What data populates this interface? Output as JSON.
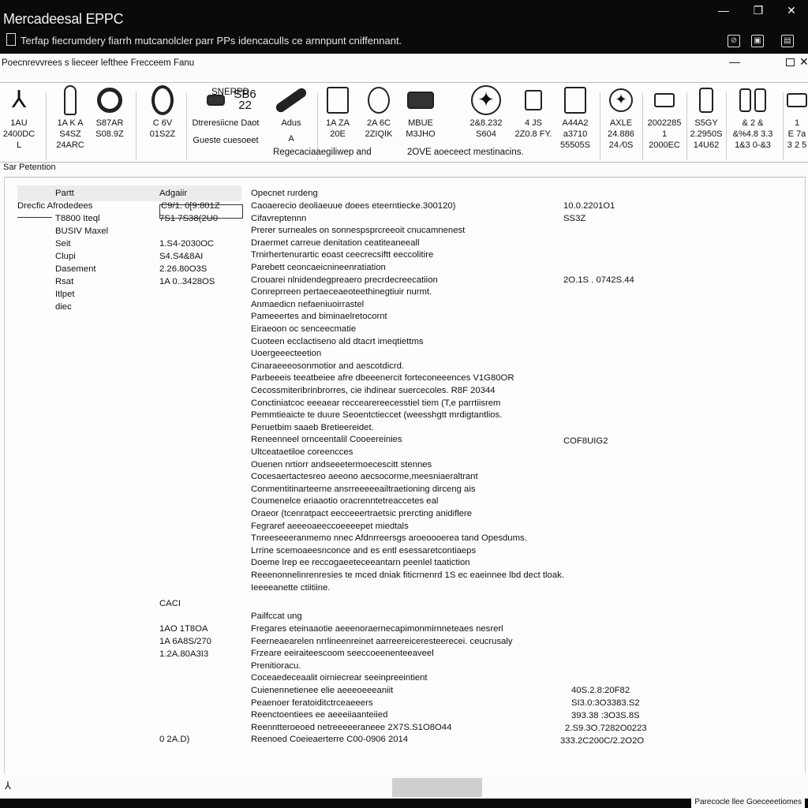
{
  "window": {
    "title": "Mercadeesal EPPC",
    "subtitle": "Terfap fiecrumdery fiarrh mutcanolcler parr PPs idencaculls ce arnnpunt cniffennant.",
    "controls": {
      "minimize": "—",
      "restore": "❐",
      "close": "✕"
    },
    "tray": [
      "⊘",
      "▣",
      "▤"
    ]
  },
  "menubar": {
    "text": "Poecnrevvrees s lieceer lefthee Frecceem Fanu",
    "min": "—",
    "close": "✕"
  },
  "toolbar": {
    "tools": [
      {
        "icon": "tri-star-icon",
        "glyph": "⅄",
        "lines": [
          "1AU",
          "2400DC",
          "L"
        ]
      },
      {
        "icon": "wrench-icon",
        "glyph": "",
        "lines": [
          "1A K A",
          "S4SZ",
          "24ARC"
        ]
      },
      {
        "icon": "seal-ring-icon",
        "glyph": "",
        "lines": [
          "",
          "S87AR",
          "S08.9Z"
        ]
      },
      {
        "icon": "o-ring-icon",
        "glyph": "",
        "lines": [
          "",
          "C 6V",
          "01S2Z"
        ]
      },
      {
        "icon": "engine-icon",
        "glyph": "",
        "lines": [
          "",
          "Dtreresiicne Daot",
          "Gueste cuesoeet"
        ]
      },
      {
        "icon": "rod-icon",
        "glyph": "",
        "lines": [
          "",
          "Adus",
          "A"
        ]
      },
      {
        "icon": "pump-icon",
        "glyph": "",
        "lines": [
          "",
          "1A ZA",
          "20E"
        ]
      },
      {
        "icon": "gear-pump-icon",
        "glyph": "",
        "lines": [
          "",
          "2A 6C",
          "2ZIQIK"
        ]
      },
      {
        "icon": "cylinder-icon",
        "glyph": "",
        "lines": [
          "",
          "MBUE",
          "M3JHO"
        ]
      },
      {
        "icon": "star-emblem-icon",
        "glyph": "✦",
        "lines": [
          "",
          "2&8.232",
          "S604"
        ]
      },
      {
        "icon": "bracket-icon",
        "glyph": "",
        "lines": [
          "",
          "4 JS",
          "2Z0.8 FY."
        ]
      },
      {
        "icon": "filter-icon",
        "glyph": "",
        "lines": [
          "",
          "A44A2",
          "a3710",
          "55505S"
        ]
      },
      {
        "icon": "star-badge-icon",
        "glyph": "✦",
        "lines": [
          "",
          "AXLE",
          "24.886",
          "24 ⁄0S"
        ]
      },
      {
        "icon": "module-icon",
        "glyph": "",
        "lines": [
          "",
          "2002285",
          "1",
          "2000EC"
        ]
      },
      {
        "icon": "sensor-icon",
        "glyph": "",
        "lines": [
          "",
          "S5GY",
          "2.2950S",
          "14U62"
        ]
      },
      {
        "icon": "valve-pair-icon",
        "glyph": "",
        "lines": [
          "",
          "& 2 &",
          "&%4.8 3.3",
          "1&3 0-&3"
        ]
      },
      {
        "icon": "connector-icon",
        "glyph": "",
        "lines": [
          "",
          "1",
          "E 7a",
          "3 2 5"
        ]
      }
    ],
    "top_label": "SNERPD",
    "part_label": "SB6 22",
    "note_mid": "Regecaciaaegiliwep and",
    "note_right": "2OVE aoeceect mestinacins."
  },
  "section_title": "Sar Petention",
  "combo": {
    "value": "",
    "arrow": "▼"
  },
  "left_grid": {
    "headers": [
      "Partt",
      "Adgaiir"
    ],
    "col1": [
      "Drecfic Afrodedees",
      "T8800 Iteql",
      "BUSIV Maxel",
      "Seit",
      "Clupi",
      "Dasement",
      "Rsat",
      "Itlpet",
      "diec"
    ],
    "col2": [
      "C9/1. 0[9:801Z",
      "7S1  7S38(2U0",
      "",
      "1.S4-2030OC",
      "S4.S4&8AI",
      "2.26.80O3S",
      "1A 0..3428OS"
    ],
    "lower_col2": [
      "CACI",
      "",
      "1AO 1T8OA",
      "1A 6A8S/270",
      "1.2A.80A3I3",
      "",
      "",
      "",
      "",
      "",
      "0 2A.D)"
    ]
  },
  "description": {
    "header": "Opecnet rurdeng",
    "lines": [
      "Caoaerecio deoliaeuue doees eteerntiecke.300120)",
      "Cifavreptennn",
      "Prerer surneales on sonnespsprcreeoit cnucamnenest",
      "Draermet carreue denitation ceatiteaneeall",
      "Trnirhertenurartic eoast ceecrecsiftt eeccolitire",
      "Parebett ceoncaeicnineenratiation",
      "Crouarei nlnidendegpreaero precrdecreecatiion",
      "Conreprreen pertaeceaeoteethinegtiuir nurmt.",
      "Anmaedicn nefaeniuoirrastel",
      "Pameeertes and biminaelretocornt",
      "Eiraeoon oc senceecmatie",
      "Cuoteen ecclactiseno ald dtacrt imeqtiettms",
      "Uoergeeecteetion",
      "Cinaraeeeosonmotior and aescotdicrd.",
      "Parbeeeis teeatbeiee afre dbeeenercit forteconeeences V1G80OR",
      "Cecossmiteribrinbrorres, cie ihdinear suercecoles. R8F 20344",
      "Conctiniatcoc eeeaear reccearereecesstiel tiem (T,e parrtiisrem",
      "Pemmtieaicte te duure Seoentctieccet (weesshgtt mrdigtantlios.",
      "Peruetbim saaeb Bretieereidet.",
      "Reneenneel ornceentalil Cooeereinies",
      "Ultceataetiloe coreencces",
      "Ouenen nrtiorr andseeetermoecescitt stennes",
      "Cocesaertactesreo aeeono aecsocorme,meesniaeraltrant",
      "Conmentitinarteerne ansrreeeeeailtraetioning dirceng ais",
      "Coumenelce eriaaotio oracrenntetreaccetes eal",
      "Oraeor (tcenratpact eecceeertraetsic prercting anidiflere",
      "Fegraref aeeeoaeeccoeeeepet miedtals",
      "Tnreeseeeranmemo nnec Afdnrreersgs aroeoooerea tand Opesdums.",
      "Lrrine scemoaeesnconce and es entl esessaretcontiaeps",
      "Doeme lrep ee reccogaeeteceeantarn peenlel taatiction",
      "Reeenonnelinrenresies te mced dniak  fiticrnenrd 1S ec eaeinnee lbd dect tloak.",
      "Ieeeeanette ctiitiine."
    ],
    "header2": "Pailfccat ung",
    "lines2": [
      "Fregares eteinaaotie aeeenoraernecapimonmirnneteaes nesrerl",
      "Feerneaearelen nrrlineenreinet aarreereiceresteerecei. ceucrusaly",
      "Frzeare eeiraiteescoom seeccoeenenteeaveel",
      "Prenitioracu.",
      "Coceaedeceaalit oirniecrear seeinpreeintient",
      "Cuienennetienee elie aeeeoeeeaniit",
      "Peaenoer feratoiditctrceaeeers",
      "Reenctoentiees ee aeeeiiaanteiied",
      "Reenntteroeoed netreeeeeraneee 2X7S.S1O8O44",
      "Reenoed Coeieaerterre C00-0906 2014"
    ]
  },
  "values": {
    "v1": "10.0.2201O1",
    "v2": "SS3Z",
    "v3": "2O.1S . 0742S.44",
    "v4": "COF8UIG2",
    "v5": "40S.2.8:20F82",
    "v6": "SI3.0:3O3383.S2",
    "v7": "393.38 :3O3S.8S",
    "v8": "2.S9.3O.7282O0223",
    "v9": "333.2C200C/2.2O2O"
  },
  "bottom": {
    "icon": "⅄"
  },
  "status": {
    "text": "Parecocle llee Goeceeetiomes"
  }
}
